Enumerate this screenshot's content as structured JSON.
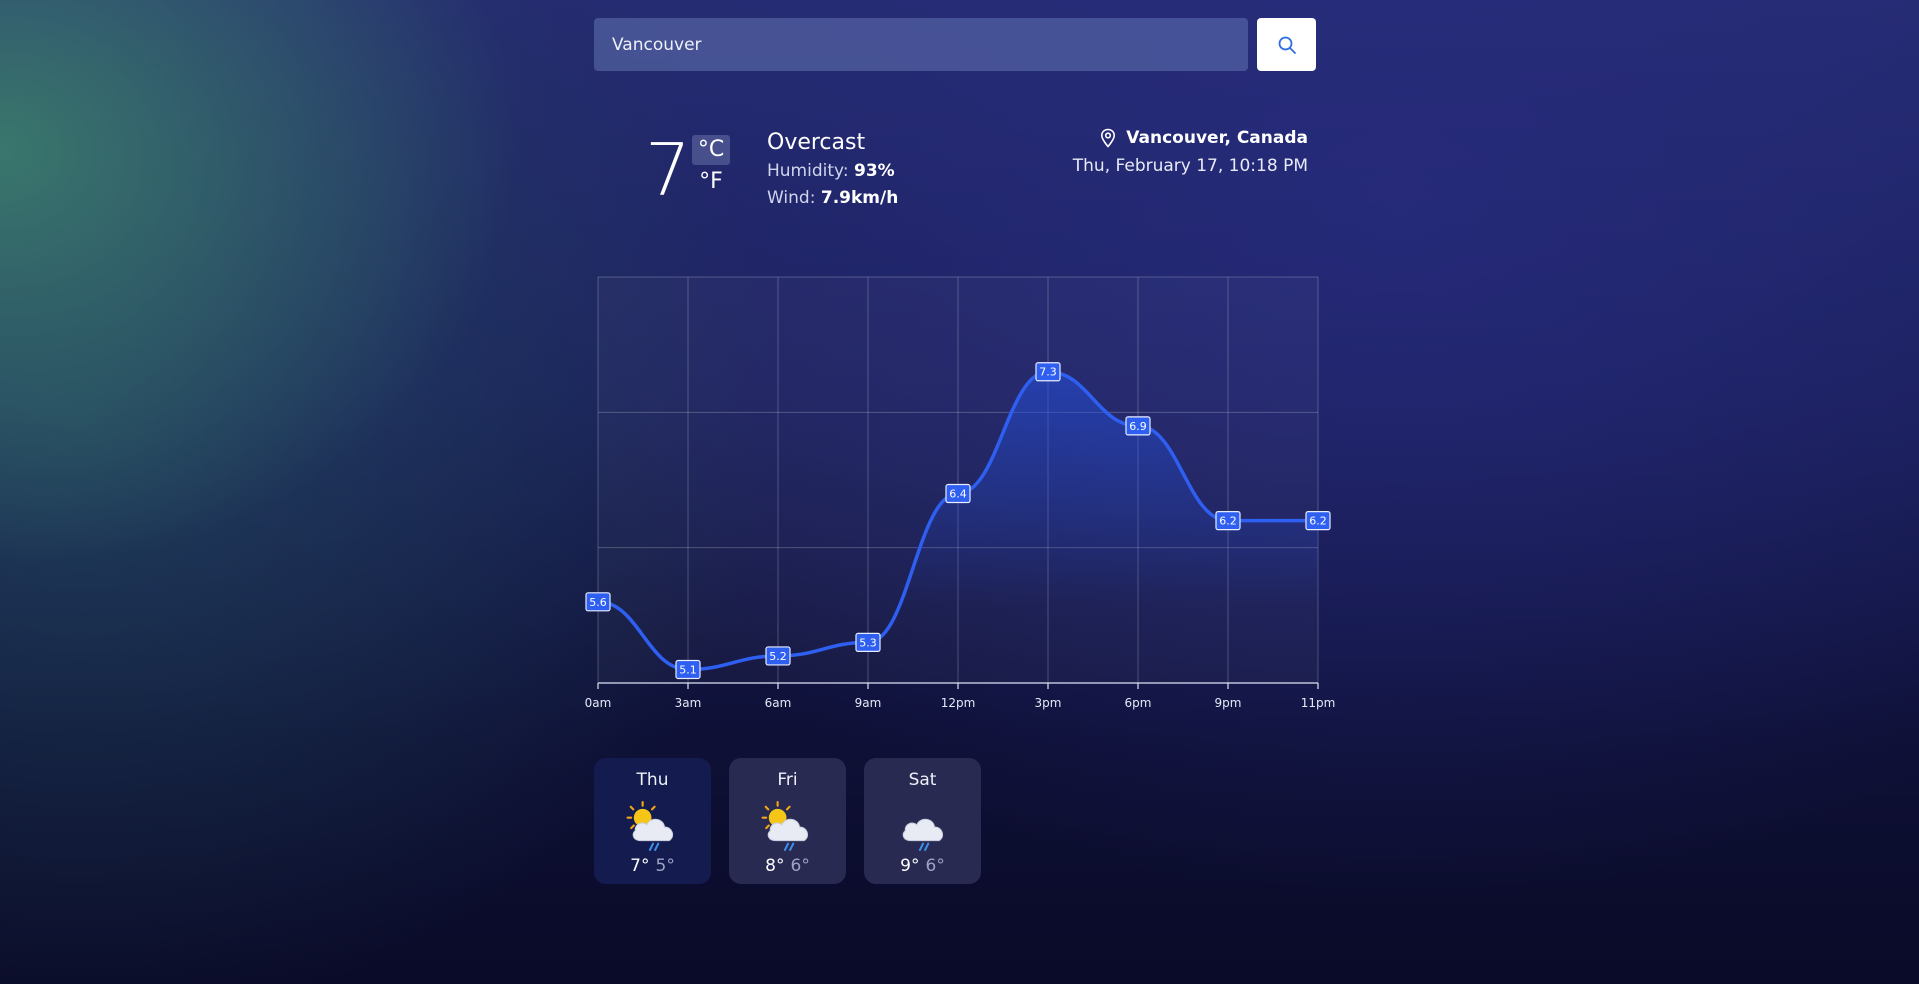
{
  "search": {
    "value": "Vancouver"
  },
  "current": {
    "temp": "7",
    "unit_c": "°C",
    "unit_f": "°F",
    "condition": "Overcast",
    "humidity_label": "Humidity:",
    "humidity_value": "93%",
    "wind_label": "Wind:",
    "wind_value": "7.9km/h",
    "location": "Vancouver, Canada",
    "datetime": "Thu, February 17, 10:18 PM"
  },
  "chart_data": {
    "type": "area",
    "x": [
      "0am",
      "3am",
      "6am",
      "9am",
      "12pm",
      "3pm",
      "6pm",
      "9pm",
      "11pm"
    ],
    "values": [
      5.6,
      5.1,
      5.2,
      5.3,
      6.4,
      7.3,
      6.9,
      6.2,
      6.2
    ],
    "ylim": [
      5.0,
      8.0
    ],
    "grid": true,
    "color": "#2f5ff0"
  },
  "forecast": [
    {
      "day": "Thu",
      "icon": "partly-sunny-rain-icon",
      "high": "7°",
      "low": "5°"
    },
    {
      "day": "Fri",
      "icon": "partly-sunny-rain-icon",
      "high": "8°",
      "low": "6°"
    },
    {
      "day": "Sat",
      "icon": "cloud-rain-icon",
      "high": "9°",
      "low": "6°"
    }
  ],
  "colors": {
    "accent": "#2f5ff0",
    "card_active": "#141b4f",
    "card": "#282a52"
  }
}
